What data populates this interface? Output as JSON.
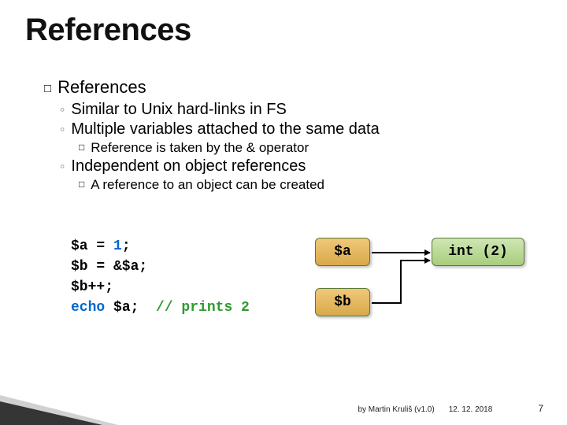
{
  "title": "References",
  "heading": "References",
  "bullets": {
    "b1": "Similar to Unix hard-links in FS",
    "b2": "Multiple variables attached to the same data",
    "b2a": "Reference is taken by the & operator",
    "b3": "Independent on object references",
    "b3a": "A reference to an object can be created"
  },
  "code": {
    "l1a": "$a = ",
    "l1b": "1",
    "l1c": ";",
    "l2": "$b = &$a;",
    "l3": "$b++;",
    "l4a": "echo",
    "l4b": " $a;  ",
    "l4c": "// prints 2"
  },
  "boxes": {
    "a": "$a",
    "b": "$b",
    "int": "int (2)"
  },
  "footer": {
    "author": "by Martin Kruliš (v1.0)",
    "date": "12. 12. 2018",
    "page": "7"
  }
}
